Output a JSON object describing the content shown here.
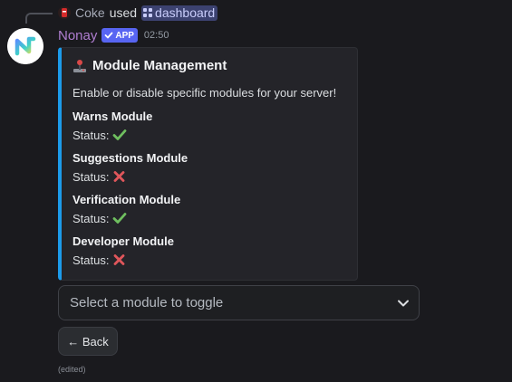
{
  "reply": {
    "user": "Coke",
    "action": "used",
    "command": "dashboard"
  },
  "message": {
    "author": "Nonay",
    "badge": "APP",
    "time": "02:50",
    "edited": "(edited)"
  },
  "embed": {
    "title": "Module Management",
    "description": "Enable or disable specific modules for your server!",
    "accent_color": "#1c9bea",
    "fields": [
      {
        "name": "Warns Module",
        "status_label": "Status:",
        "status_icon": "check-icon"
      },
      {
        "name": "Suggestions Module",
        "status_label": "Status:",
        "status_icon": "cross-icon"
      },
      {
        "name": "Verification Module",
        "status_label": "Status:",
        "status_icon": "check-icon"
      },
      {
        "name": "Developer Module",
        "status_label": "Status:",
        "status_icon": "cross-icon"
      }
    ]
  },
  "select": {
    "placeholder": "Select a module to toggle"
  },
  "buttons": {
    "back": "← Back"
  },
  "colors": {
    "username": "#b07ed1",
    "app_badge": "#5865f2",
    "check": "#6fbf5f",
    "cross": "#e0565b"
  }
}
